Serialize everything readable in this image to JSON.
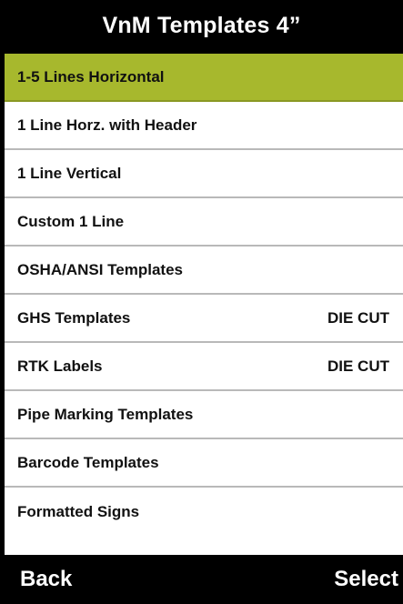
{
  "header": {
    "title": "VnM Templates 4”"
  },
  "menu": {
    "items": [
      {
        "label": "1-5 Lines Horizontal",
        "tag": "",
        "selected": true
      },
      {
        "label": "1 Line Horz. with Header",
        "tag": ""
      },
      {
        "label": "1 Line Vertical",
        "tag": ""
      },
      {
        "label": "Custom 1 Line",
        "tag": ""
      },
      {
        "label": "OSHA/ANSI Templates",
        "tag": ""
      },
      {
        "label": "GHS Templates",
        "tag": "DIE CUT"
      },
      {
        "label": "RTK Labels",
        "tag": "DIE CUT"
      },
      {
        "label": "Pipe Marking Templates",
        "tag": ""
      },
      {
        "label": "Barcode Templates",
        "tag": ""
      },
      {
        "label": "Formatted Signs",
        "tag": ""
      }
    ]
  },
  "footer": {
    "back_label": "Back",
    "select_label": "Select"
  },
  "colors": {
    "background": "#000000",
    "highlight": "#a7b82d",
    "divider": "#b9b9b9"
  }
}
